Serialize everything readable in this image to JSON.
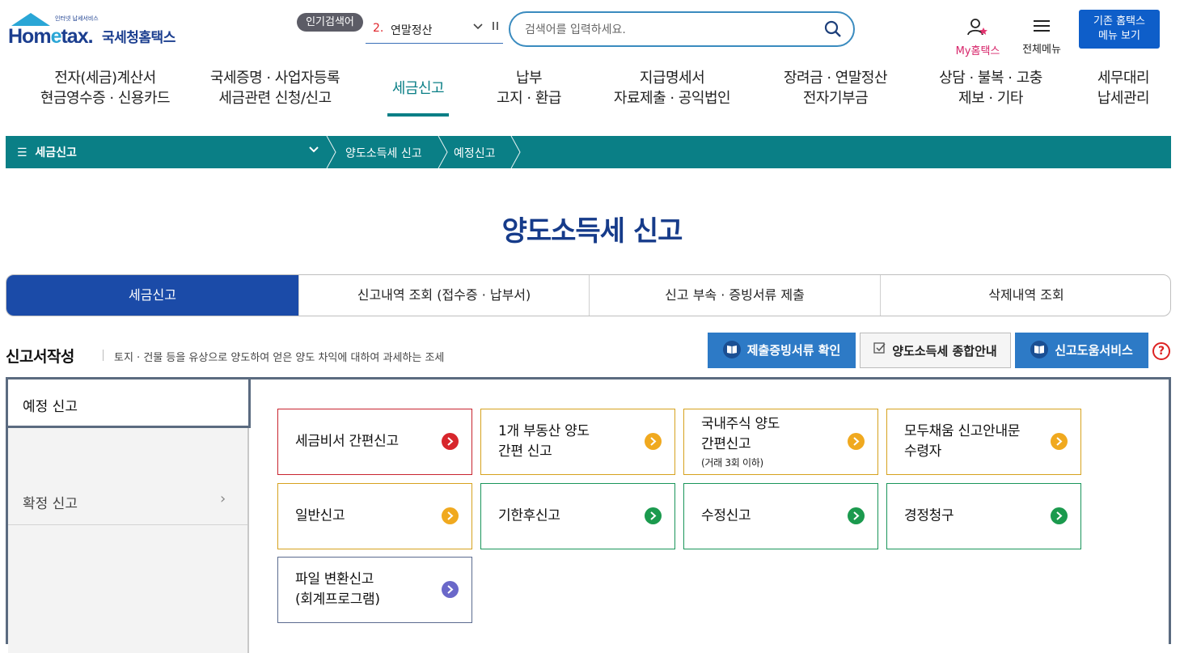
{
  "header": {
    "logo_sub": "인터넷 납세서비스",
    "logo_word_1": "Hom",
    "logo_word_e": "e",
    "logo_word_2": "tax.",
    "logo_kr": "국세청홈택스",
    "popular_label": "인기검색어",
    "popular_rank": "2.",
    "popular_term": "연말정산",
    "search_placeholder": "검색어를 입력하세요.",
    "my_hometax": "My홈택스",
    "all_menu": "전체메뉴",
    "old_menu_line1": "기존 홈택스",
    "old_menu_line2": "메뉴 보기"
  },
  "gnb": [
    {
      "line1": "전자(세금)계산서",
      "line2": "현금영수증 · 신용카드"
    },
    {
      "line1": "국세증명 · 사업자등록",
      "line2": "세금관련 신청/신고"
    },
    {
      "line1": "세금신고",
      "line2": ""
    },
    {
      "line1": "납부",
      "line2": "고지 · 환급"
    },
    {
      "line1": "지급명세서",
      "line2": "자료제출 · 공익법인"
    },
    {
      "line1": "장려금 · 연말정산",
      "line2": "전자기부금"
    },
    {
      "line1": "상담 · 불복 · 고충",
      "line2": "제보 · 기타"
    },
    {
      "line1": "세무대리",
      "line2": "납세관리"
    }
  ],
  "breadcrumb": {
    "menu_label": "세금신고",
    "items": [
      "양도소득세 신고",
      "예정신고"
    ]
  },
  "page_title": "양도소득세 신고",
  "tabs": [
    "세금신고",
    "신고내역 조회 (접수증 · 납부서)",
    "신고 부속 · 증빙서류 제출",
    "삭제내역 조회"
  ],
  "section": {
    "title": "신고서작성",
    "description": "토지 · 건물 등을 유상으로 양도하여 얻은 양도 차익에 대하여 과세하는 조세",
    "btn_docs": "제출증빙서류 확인",
    "btn_guide": "양도소득세 종합안내",
    "btn_help": "신고도움서비스",
    "help_mark": "?"
  },
  "side_menu": [
    {
      "label": "예정 신고",
      "chevron": ""
    },
    {
      "label": "확정 신고",
      "chevron": "›"
    }
  ],
  "cards": [
    {
      "line1": "세금비서 간편신고",
      "line2": "",
      "note": "",
      "color": "red"
    },
    {
      "line1": "1개 부동산 양도",
      "line2": "간편 신고",
      "note": "",
      "color": "yel"
    },
    {
      "line1": "국내주식 양도",
      "line2": "간편신고",
      "note": "(거래 3회 이하)",
      "color": "yel"
    },
    {
      "line1": "모두채움 신고안내문",
      "line2": "수령자",
      "note": "",
      "color": "yel"
    },
    {
      "line1": "일반신고",
      "line2": "",
      "note": "",
      "color": "yel"
    },
    {
      "line1": "기한후신고",
      "line2": "",
      "note": "",
      "color": "grn"
    },
    {
      "line1": "수정신고",
      "line2": "",
      "note": "",
      "color": "grn"
    },
    {
      "line1": "경정청구",
      "line2": "",
      "note": "",
      "color": "grn"
    },
    {
      "line1": "파일 변환신고",
      "line2": "(회계프로그램)",
      "note": "",
      "color": "pur"
    }
  ],
  "colors": {
    "teal": "#0a7f86",
    "navy_title": "#163b8a",
    "tab_active": "#1b4ba8",
    "btn_blue": "#2d7ac6",
    "red": "#d7262c",
    "yellow": "#f0a91f",
    "green": "#1b9a4e",
    "purple": "#6a68c9"
  }
}
